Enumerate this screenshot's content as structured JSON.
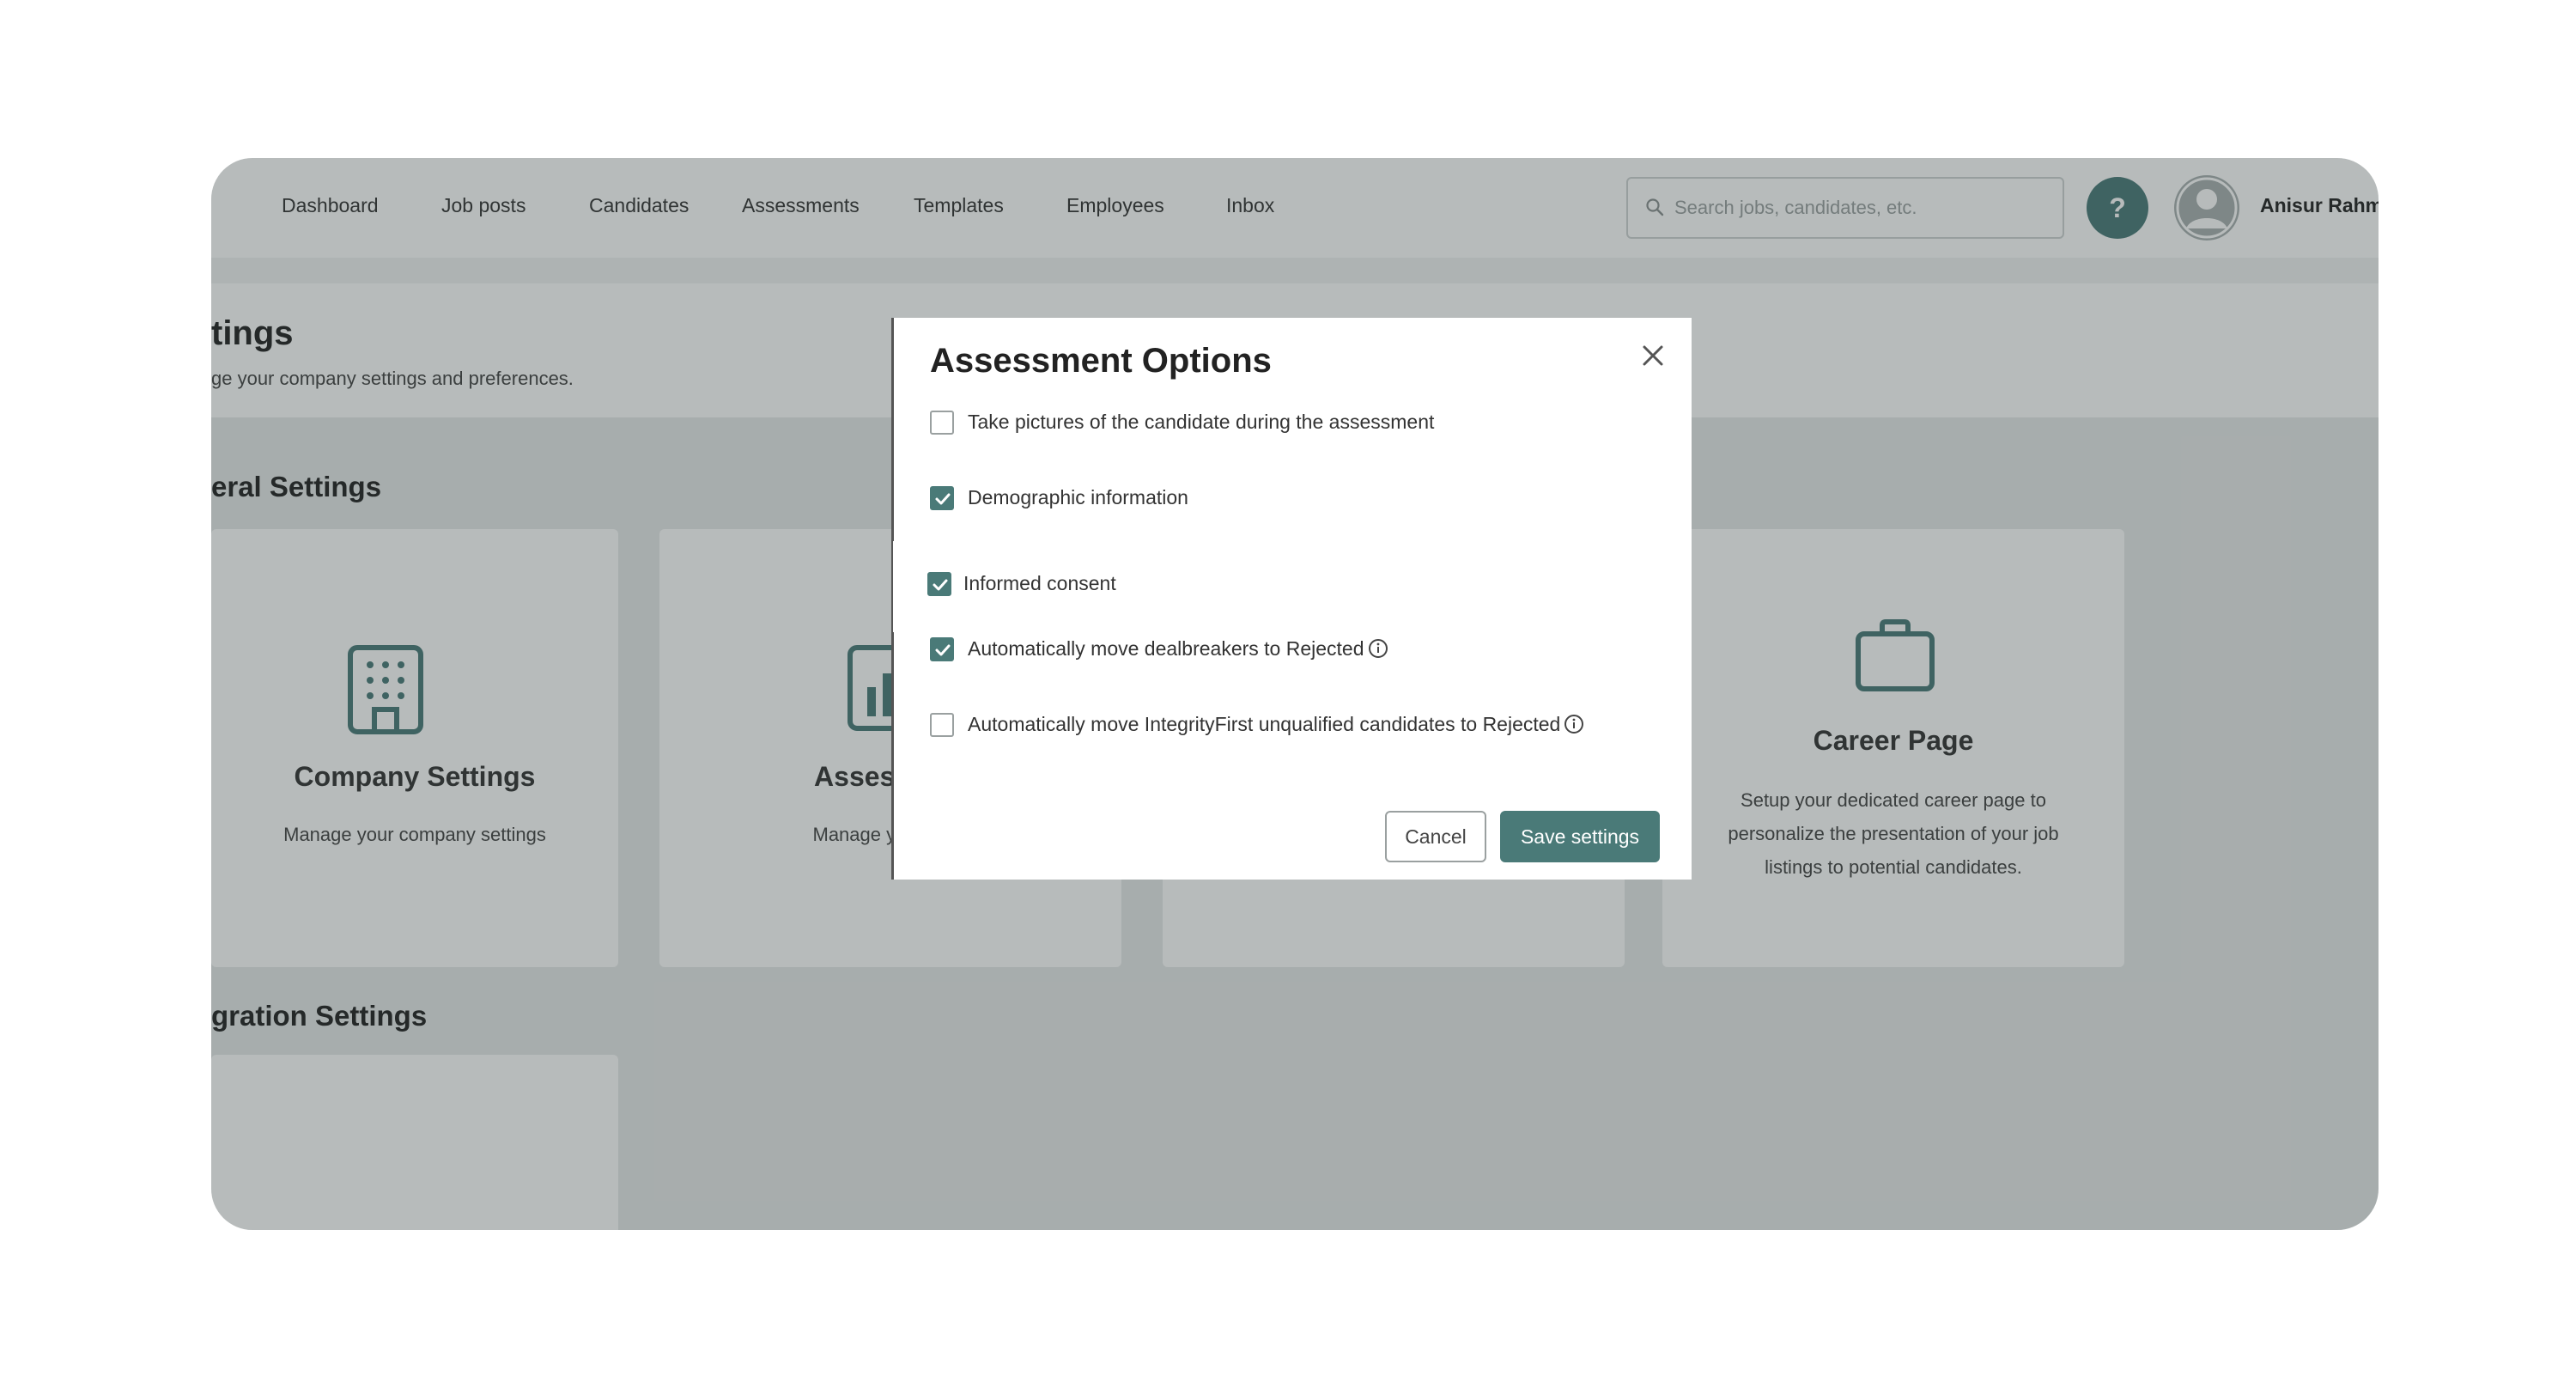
{
  "nav": {
    "items": [
      "Dashboard",
      "Job posts",
      "Candidates",
      "Assessments",
      "Templates",
      "Employees",
      "Inbox"
    ],
    "search_placeholder": "Search jobs, candidates, etc.",
    "help_label": "?",
    "user_name": "Anisur Rahm"
  },
  "page": {
    "title": "tings",
    "subtitle": "ge your company settings and preferences.",
    "general_section": "eral Settings",
    "integration_section": "gration Settings"
  },
  "cards": [
    {
      "title": "Company Settings",
      "desc": "Manage your company settings",
      "icon": "building-icon"
    },
    {
      "title": "Assessmen",
      "desc": "Manage your asse",
      "icon": "chart-icon"
    },
    {
      "title": "Career Page",
      "desc": "Setup your dedicated career page to personalize the presentation of your job listings to potential candidates.",
      "icon": "briefcase-icon"
    }
  ],
  "modal": {
    "title": "Assessment Options",
    "options": [
      {
        "label": "Take pictures of the candidate during the assessment",
        "checked": false,
        "info": false
      },
      {
        "label": "Demographic information",
        "checked": true,
        "info": false
      },
      {
        "label": "Informed consent",
        "checked": true,
        "info": false,
        "highlighted": true
      },
      {
        "label": "Automatically move dealbreakers to Rejected",
        "checked": true,
        "info": true
      },
      {
        "label": "Automatically move IntegrityFirst unqualified candidates to Rejected",
        "checked": false,
        "info": true
      }
    ],
    "cancel_label": "Cancel",
    "save_label": "Save settings"
  },
  "colors": {
    "accent": "#4a7a78",
    "overlay": "#2d3737"
  }
}
